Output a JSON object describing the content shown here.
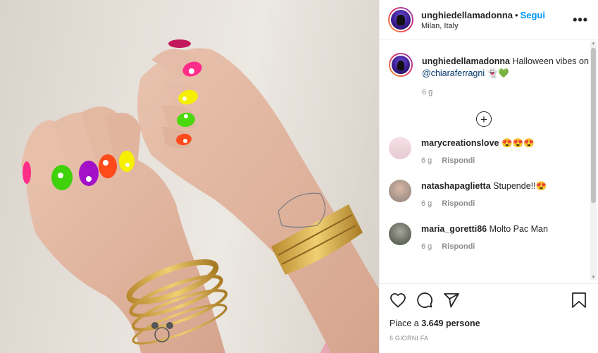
{
  "header": {
    "username": "unghiedellamadonna",
    "separator": "•",
    "follow_label": "Segui",
    "location": "Milan, Italy",
    "more_label": "•••"
  },
  "caption": {
    "username": "unghiedellamadonna",
    "text": "Halloween vibes on",
    "mention": "@chiaraferragni",
    "emojis": "👻💚",
    "time": "6 g"
  },
  "load_more_label": "+",
  "comments": [
    {
      "username": "marycreationslove",
      "text": "😍😍😍",
      "time": "6 g",
      "reply_label": "Rispondi"
    },
    {
      "username": "natashapaglietta",
      "text": "Stupende!!😍",
      "time": "6 g",
      "reply_label": "Rispondi"
    },
    {
      "username": "maria_goretti86",
      "text": "Molto Pac Man",
      "time": "6 g",
      "reply_label": "Rispondi"
    }
  ],
  "likes": {
    "prefix": "Piace a",
    "count": "3.649 persone"
  },
  "post_date": "6 GIORNI FA",
  "colors": {
    "follow": "#0095f6",
    "text": "#262626",
    "meta": "#8e8e8e"
  },
  "icons": [
    "heart-icon",
    "comment-icon",
    "share-icon",
    "bookmark-icon"
  ]
}
